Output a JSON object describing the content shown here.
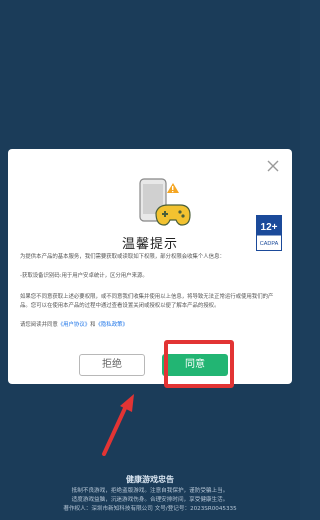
{
  "dialog": {
    "title": "温馨提示",
    "paragraph1": "为提供本产品的基本服务，我们需要获取或读取如下权限，部分权限会收集个人信息：",
    "paragraph2": "-获取设备识别码:用于用户安卓统计，区分用户来源。",
    "paragraph3": "如果您不同意获取上述必要权限，或不同意我们收集并使用以上信息，将导致无法正常运行或使用我们的产品。您可以在使用本产品的过程中通过查看设置关闭或授权以便了解本产品的授权。",
    "paragraph4_prefix": "请您阅读并同意",
    "user_agreement": "《用户协议》",
    "and": "和",
    "privacy_policy": "《隐私政策》",
    "reject_label": "拒绝",
    "agree_label": "同意",
    "rating": "12+",
    "rating_sub": "CADPA"
  },
  "footer": {
    "title": "健康游戏忠告",
    "line1": "抵制不良游戏，拒绝盗版游戏。注意自我保护，谨防受骗上当。",
    "line2": "适度游戏益脑，沉迷游戏伤身。合理安排时间，享受健康生活。",
    "line3": "著作权人：深圳市新知科技有限公司  文号/登记号：2023SR0045335"
  },
  "colors": {
    "background": "#1c3e5c",
    "agree": "#22b573",
    "highlight": "#e23434",
    "link": "#1a73e8"
  }
}
